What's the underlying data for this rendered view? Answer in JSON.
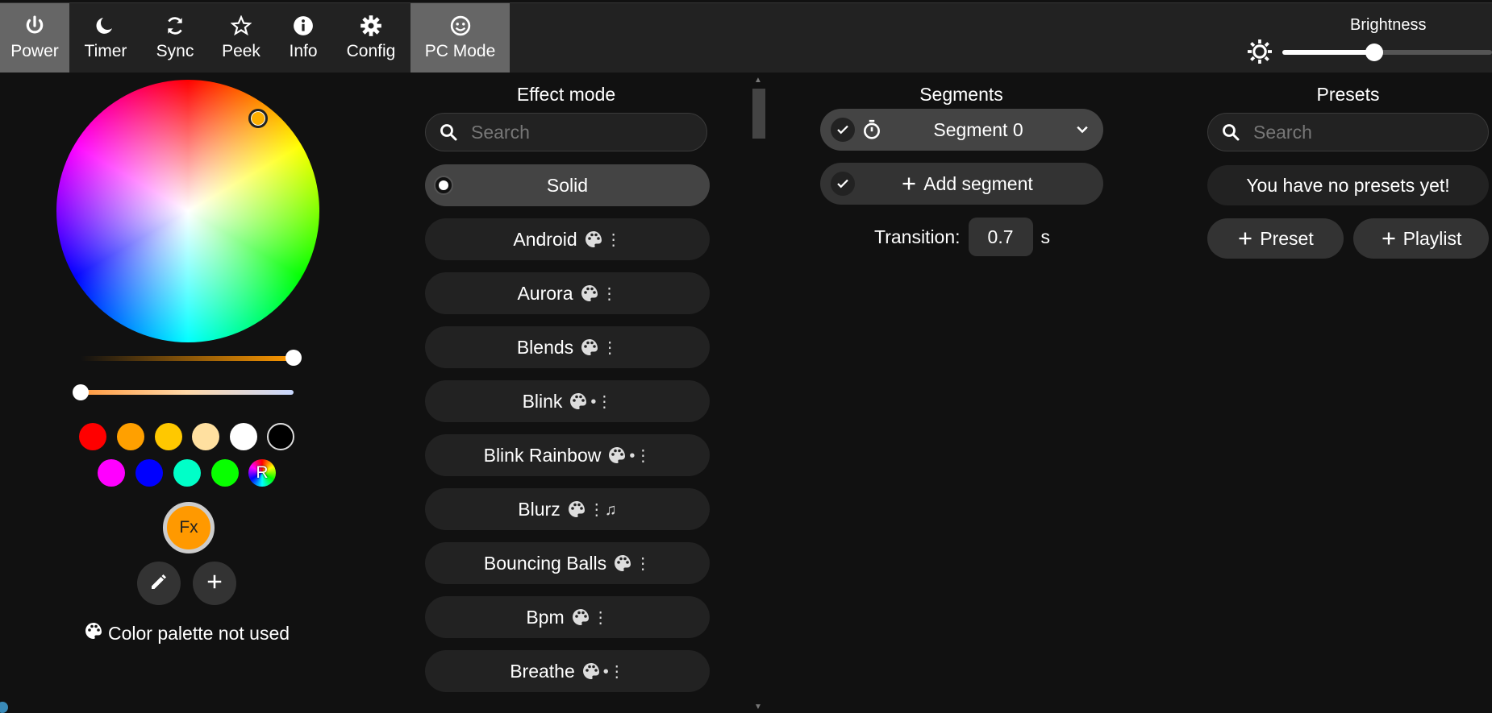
{
  "topbar": {
    "tabs": [
      {
        "label": "Power",
        "icon": "power-icon",
        "active": true
      },
      {
        "label": "Timer",
        "icon": "moon-icon",
        "active": false
      },
      {
        "label": "Sync",
        "icon": "sync-icon",
        "active": false
      },
      {
        "label": "Peek",
        "icon": "star-icon",
        "active": false
      },
      {
        "label": "Info",
        "icon": "info-icon",
        "active": false
      },
      {
        "label": "Config",
        "icon": "gear-icon",
        "active": false
      },
      {
        "label": "PC Mode",
        "icon": "smiley-icon",
        "active": true
      }
    ],
    "brightness": {
      "label": "Brightness",
      "value": 0.44
    }
  },
  "color": {
    "brightness_slider_value": 1.0,
    "white_slider_value": 0.0,
    "swatches": [
      "#ff0000",
      "#ffa000",
      "#ffc800",
      "#ffe0a0",
      "#ffffff",
      "#000000",
      "#ff00ff",
      "#0000ff",
      "#00ffc8",
      "#08ff00"
    ],
    "random_label": "R",
    "fx_label": "Fx",
    "palette_note": "Color palette not used",
    "accent": "#ff9900"
  },
  "effects": {
    "title": "Effect mode",
    "search_placeholder": "Search",
    "items": [
      {
        "name": "Solid",
        "selected": true,
        "flags": ""
      },
      {
        "name": "Android",
        "selected": false,
        "flags": "⋮"
      },
      {
        "name": "Aurora",
        "selected": false,
        "flags": "⋮"
      },
      {
        "name": "Blends",
        "selected": false,
        "flags": "⋮"
      },
      {
        "name": "Blink",
        "selected": false,
        "flags": "•⋮"
      },
      {
        "name": "Blink Rainbow",
        "selected": false,
        "flags": "•⋮"
      },
      {
        "name": "Blurz",
        "selected": false,
        "flags": "⋮♫"
      },
      {
        "name": "Bouncing Balls",
        "selected": false,
        "flags": "⋮"
      },
      {
        "name": "Bpm",
        "selected": false,
        "flags": "⋮"
      },
      {
        "name": "Breathe",
        "selected": false,
        "flags": "•⋮"
      }
    ]
  },
  "segments": {
    "title": "Segments",
    "segment_name": "Segment 0",
    "add_label": "Add segment",
    "transition_label": "Transition:",
    "transition_value": "0.7",
    "transition_unit": "s"
  },
  "presets": {
    "title": "Presets",
    "search_placeholder": "Search",
    "empty_message": "You have no presets yet!",
    "preset_button": "Preset",
    "playlist_button": "Playlist"
  }
}
